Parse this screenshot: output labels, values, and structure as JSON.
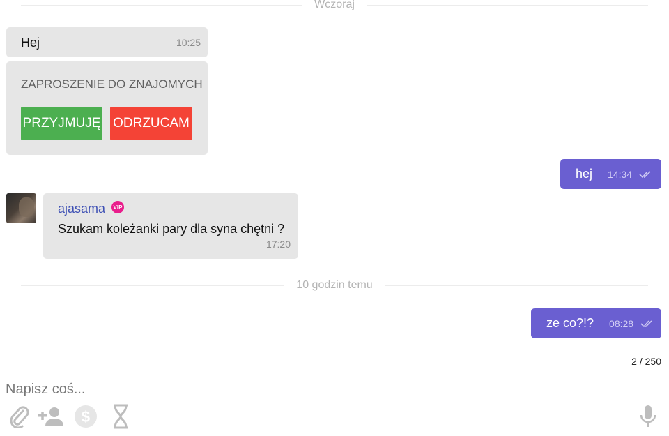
{
  "dividers": {
    "yesterday": "Wczoraj",
    "recent": "10 godzin temu"
  },
  "messages": {
    "hej_in": {
      "text": "Hej",
      "time": "10:25"
    },
    "invite": {
      "title": "ZAPROSZENIE DO ZNAJOMYCH",
      "accept": "PRZYJMUJĘ",
      "reject": "ODRZUCAM"
    },
    "hej_out": {
      "text": "hej",
      "time": "14:34"
    },
    "ajasama": {
      "sender": "ajasama",
      "badge": "VIP",
      "text": "Szukam koleżanki pary dla syna chętni ?",
      "time": "17:20"
    },
    "zeco_out": {
      "text": "ze co?!?",
      "time": "08:28"
    }
  },
  "counter": "2 / 250",
  "composer": {
    "placeholder": "Napisz coś..."
  },
  "colors": {
    "outgoing": "#6a5fd1",
    "accept": "#4caf50",
    "reject": "#f44336",
    "vip": "#e91e8c",
    "sender": "#3f51b5"
  },
  "icons": [
    "paperclip-icon",
    "add-friend-icon",
    "dollar-icon",
    "hourglass-icon",
    "microphone-icon"
  ]
}
